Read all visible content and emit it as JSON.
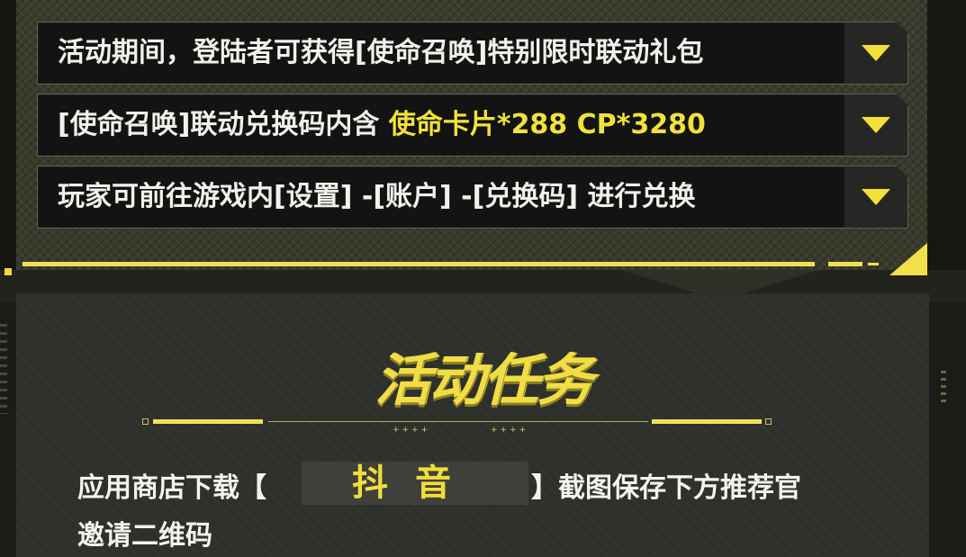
{
  "rows": [
    {
      "text": "活动期间，登陆者可获得[使命召唤]特别限时联动礼包",
      "highlight": ""
    },
    {
      "text": "[使命召唤]联动兑换码内含 ",
      "highlight": "使命卡片*288 CP*3280"
    },
    {
      "text": "玩家可前往游戏内[设置] -[账户] -[兑换码] 进行兑换",
      "highlight": ""
    }
  ],
  "toggle_icon": "chevron-down-triangle-icon",
  "section": {
    "title": "活动任务",
    "line1_pre": "应用商店下载【",
    "app_name": "抖音",
    "line1_post": "】截图保存下方推荐官",
    "line2": "邀请二维码"
  },
  "colors": {
    "accent": "#f1e03a",
    "text": "#f1f1ea",
    "row_bg": "#121312"
  }
}
